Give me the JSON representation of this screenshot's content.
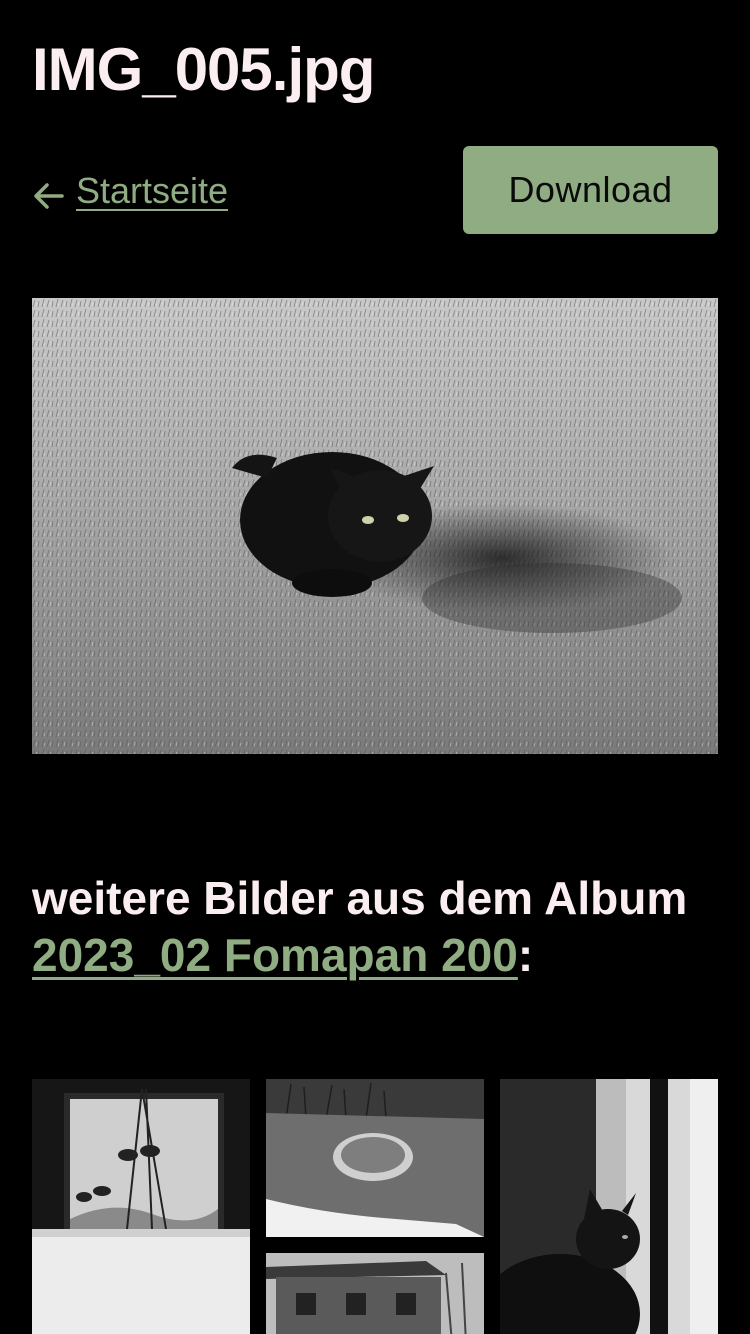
{
  "page": {
    "title": "IMG_005.jpg"
  },
  "nav": {
    "back_label": "Startseite",
    "back_icon": "arrow-left-icon",
    "download_label": "Download"
  },
  "photo": {
    "alt_subject": "black cat on grass"
  },
  "album": {
    "prefix": "weitere Bilder aus dem Album ",
    "link_label": "2023_02 Fomapan 200",
    "suffix": ":"
  },
  "thumbnails": [
    {
      "subject": "plant in window"
    },
    {
      "subject": "bowl on ground"
    },
    {
      "subject": "cat at window"
    },
    {
      "subject": "wooden house"
    }
  ],
  "colors": {
    "background": "#000000",
    "text": "#fbeef0",
    "accent": "#8fac82"
  }
}
